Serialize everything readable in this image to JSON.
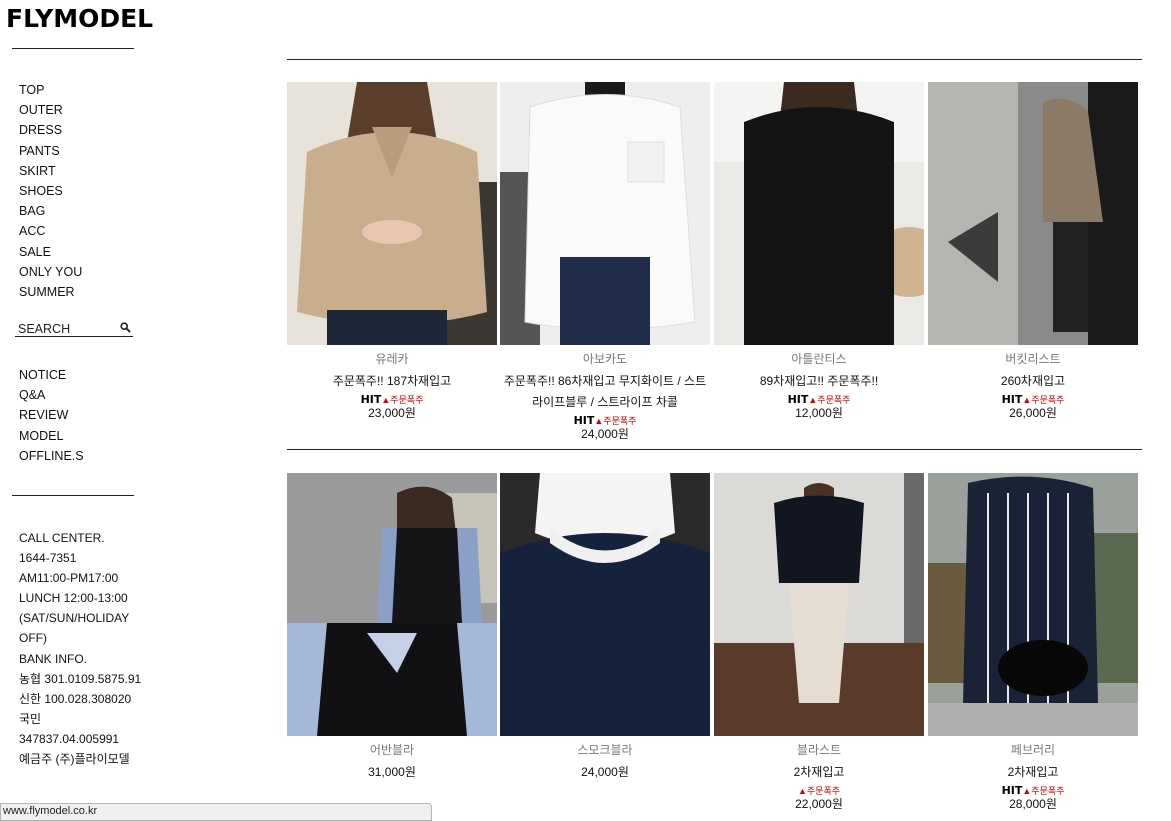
{
  "logo": "FLYMODEL",
  "menu": [
    "TOP",
    "OUTER",
    "DRESS",
    "PANTS",
    "SKIRT",
    "SHOES",
    "BAG",
    "ACC",
    "SALE",
    "ONLY YOU",
    "SUMMER"
  ],
  "search": {
    "label": "SEARCH",
    "icon": "search-icon"
  },
  "community": [
    "NOTICE",
    "Q&A",
    "REVIEW",
    "MODEL",
    "OFFLINE.S"
  ],
  "info": [
    "CALL CENTER.",
    "1644-7351",
    "AM11:00-PM17:00",
    "LUNCH 12:00-13:00",
    "(SAT/SUN/HOLIDAY OFF)",
    "BANK INFO.",
    "농협 301.0109.5875.91",
    "신한 100.028.308020",
    "국민 347837.04.005991",
    "예금주 (주)플라이모델"
  ],
  "products": [
    {
      "name": "유레카",
      "desc": "주문폭주!! 187차재입고",
      "hit": "HIT",
      "hot": "▲주문폭주",
      "price": "23,000원"
    },
    {
      "name": "아보카도",
      "desc": "주문폭주!! 86차재입고 무지화이트 / 스트라이프블루 / 스트라이프 차콜",
      "hit": "HIT",
      "hot": "▲주문폭주",
      "price": "24,000원"
    },
    {
      "name": "아틀란티스",
      "desc": "89차재입고!! 주문폭주!!",
      "hit": "HIT",
      "hot": "▲주문폭주",
      "price": "12,000원"
    },
    {
      "name": "버킷리스트",
      "desc": "260차재입고",
      "hit": "HIT",
      "hot": "▲주문폭주",
      "price": "26,000원"
    },
    {
      "name": "어반블라",
      "desc": "",
      "hit": "",
      "hot": "",
      "price": "31,000원"
    },
    {
      "name": "스모크블라",
      "desc": "",
      "hit": "",
      "hot": "",
      "price": "24,000원"
    },
    {
      "name": "블라스트",
      "desc": "2차재입고",
      "hit": "",
      "hot": "▲주문폭주",
      "price": "22,000원"
    },
    {
      "name": "페브러리",
      "desc": "2차재입고",
      "hit": "HIT",
      "hot": "▲주문폭주",
      "price": "28,000원"
    }
  ],
  "status_url": "www.flymodel.co.kr"
}
